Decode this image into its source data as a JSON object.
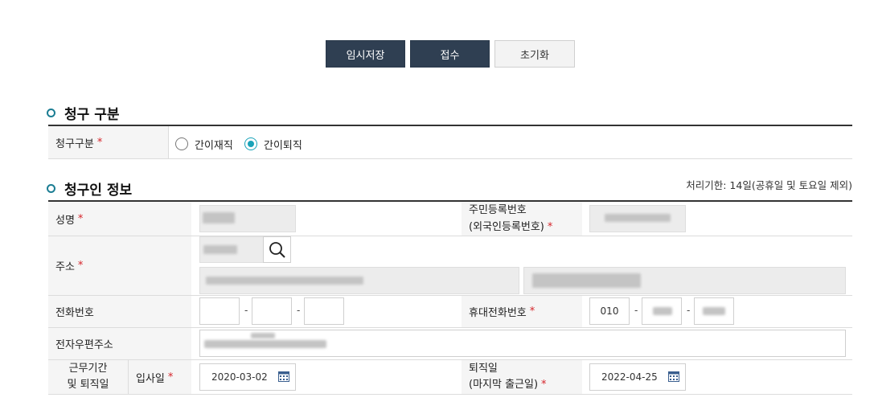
{
  "actions": {
    "save_temp": "임시저장",
    "submit": "접수",
    "reset": "초기화"
  },
  "claim_section": {
    "title": "청구 구분",
    "label": "청구구분",
    "required_mark": "*",
    "options": [
      {
        "label": "간이재직",
        "checked": false
      },
      {
        "label": "간이퇴직",
        "checked": true
      }
    ]
  },
  "claimant_section": {
    "title": "청구인 정보",
    "note": "처리기한: 14일(공휴일 및 토요일 제외)",
    "required_mark": "*",
    "name_label": "성명",
    "rrn_label_line1": "주민등록번호",
    "rrn_label_line2": "(외국인등록번호)",
    "address_label": "주소",
    "phone_label": "전화번호",
    "phone_sep": "-",
    "mobile_label": "휴대전화번호",
    "mobile_prefix": "010",
    "email_label": "전자우편주소",
    "period_label_line1": "근무기간",
    "period_label_line2": "및 퇴직일",
    "hire_label": "입사일",
    "hire_date": "2020-03-02",
    "leave_label_line1": "퇴직일",
    "leave_label_line2": "(마지막 출근일)",
    "leave_date": "2022-04-25"
  },
  "icons": {
    "search": "search-icon",
    "calendar": "calendar-icon"
  },
  "colors": {
    "button_dark": "#2f3f52",
    "accent": "#19a3b9",
    "required": "#d5242a"
  }
}
